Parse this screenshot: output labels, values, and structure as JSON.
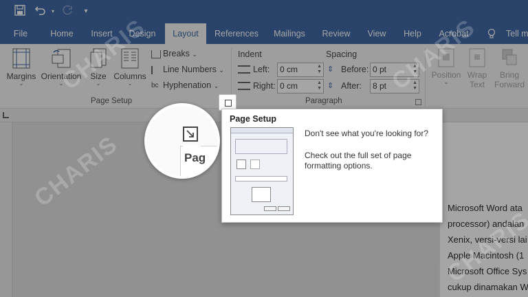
{
  "titlebar": {
    "save_icon": "save-icon",
    "undo_icon": "undo-icon",
    "redo_icon": "redo-icon",
    "customize_icon": "customize-qat-icon"
  },
  "tabs": [
    {
      "label": "File"
    },
    {
      "label": "Home"
    },
    {
      "label": "Insert"
    },
    {
      "label": "Design"
    },
    {
      "label": "Layout"
    },
    {
      "label": "References"
    },
    {
      "label": "Mailings"
    },
    {
      "label": "Review"
    },
    {
      "label": "View"
    },
    {
      "label": "Help"
    },
    {
      "label": "Acrobat"
    },
    {
      "label": "Tell m"
    }
  ],
  "ribbon": {
    "page_setup": {
      "margins": "Margins",
      "orientation": "Orientation",
      "size": "Size",
      "columns": "Columns",
      "breaks": "Breaks",
      "line_numbers": "Line Numbers",
      "hyphenation": "Hyphenation",
      "group_label": "Page Setup"
    },
    "paragraph": {
      "indent_label": "Indent",
      "spacing_label": "Spacing",
      "left_label": "Left:",
      "left_value": "0 cm",
      "right_label": "Right:",
      "right_value": "0 cm",
      "before_label": "Before:",
      "before_value": "0 pt",
      "after_label": "After:",
      "after_value": "8 pt",
      "group_label": "Paragraph"
    },
    "arrange": {
      "position_l1": "Position",
      "wrap_l1": "Wrap",
      "wrap_l2": "Text",
      "bring_l1": "Bring",
      "bring_l2": "Forward"
    }
  },
  "zoom": {
    "title": "Pag"
  },
  "tooltip": {
    "title": "Page Setup",
    "line1": "Don't see what you're looking for?",
    "line2": "Check out the full set of page",
    "line3": "formatting options."
  },
  "document": {
    "lines": [
      "Microsoft Word ata",
      "processor) andalan",
      "Xenix, versi-versi lai",
      "Apple Macintosh (1",
      "Microsoft Office Sys",
      "cukup dinamakan W"
    ]
  },
  "watermark": "CHARIS"
}
